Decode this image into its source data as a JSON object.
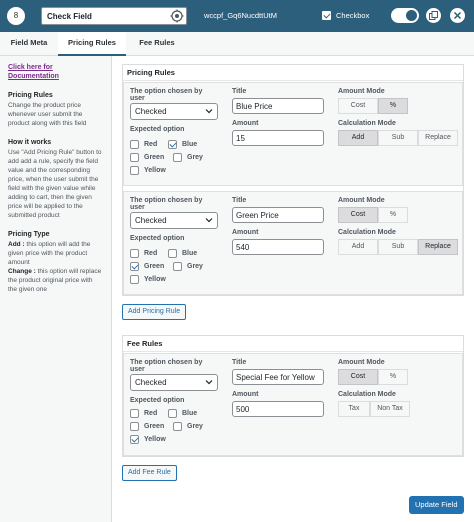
{
  "header": {
    "number": "8",
    "field_name": "Check Field",
    "field_key": "wccpf_Gq6NucdttUtM",
    "type_label": "Checkbox",
    "colors": {
      "header_bg": "#2c5f7c",
      "accent": "#2271b1"
    }
  },
  "tabs": [
    {
      "label": "Field Meta"
    },
    {
      "label": "Pricing Rules"
    },
    {
      "label": "Fee Rules"
    }
  ],
  "sidebar": {
    "doc_link": "Click here for Documentation",
    "pricing_title": "Pricing Rules",
    "pricing_desc": "Change the product price whenever user submit the product along with this field",
    "how_title": "How it works",
    "how_desc": "Use \"Add Pricing Rule\" button to add add a rule, specify the field value and the corresponding price, when the user submit the field with the given value while adding to cart, then the given price will be applied to the submitted product",
    "type_title": "Pricing Type",
    "add_label": "Add :",
    "add_desc": " this option will add the given price with the product amount",
    "change_label": "Change :",
    "change_desc": " this option will replace the product original price with the given one"
  },
  "labels": {
    "option_chosen": "The option chosen by user",
    "expected_option": "Expected option",
    "title": "Title",
    "amount": "Amount",
    "amount_mode": "Amount Mode",
    "calc_mode": "Calculation Mode"
  },
  "pricing": {
    "section_title": "Pricing Rules",
    "rules": [
      {
        "select_value": "Checked",
        "options": [
          "Red",
          "Blue",
          "Green",
          "Grey",
          "Yellow"
        ],
        "title": "Blue Price",
        "amount": "15",
        "amount_modes": [
          "Cost",
          "%"
        ],
        "calc_modes": [
          "Add",
          "Sub",
          "Replace"
        ]
      },
      {
        "select_value": "Checked",
        "options": [
          "Red",
          "Blue",
          "Green",
          "Grey",
          "Yellow"
        ],
        "title": "Green Price",
        "amount": "540",
        "amount_modes": [
          "Cost",
          "%"
        ],
        "calc_modes": [
          "Add",
          "Sub",
          "Replace"
        ]
      }
    ],
    "add_button": "Add Pricing Rule"
  },
  "fee": {
    "section_title": "Fee Rules",
    "rules": [
      {
        "select_value": "Checked",
        "options": [
          "Red",
          "Blue",
          "Green",
          "Grey",
          "Yellow"
        ],
        "title": "Special Fee for Yellow",
        "amount": "500",
        "amount_modes": [
          "Cost",
          "%"
        ],
        "calc_modes": [
          "Tax",
          "Non Tax"
        ]
      }
    ],
    "add_button": "Add Fee Rule"
  },
  "update_button": "Update Field"
}
